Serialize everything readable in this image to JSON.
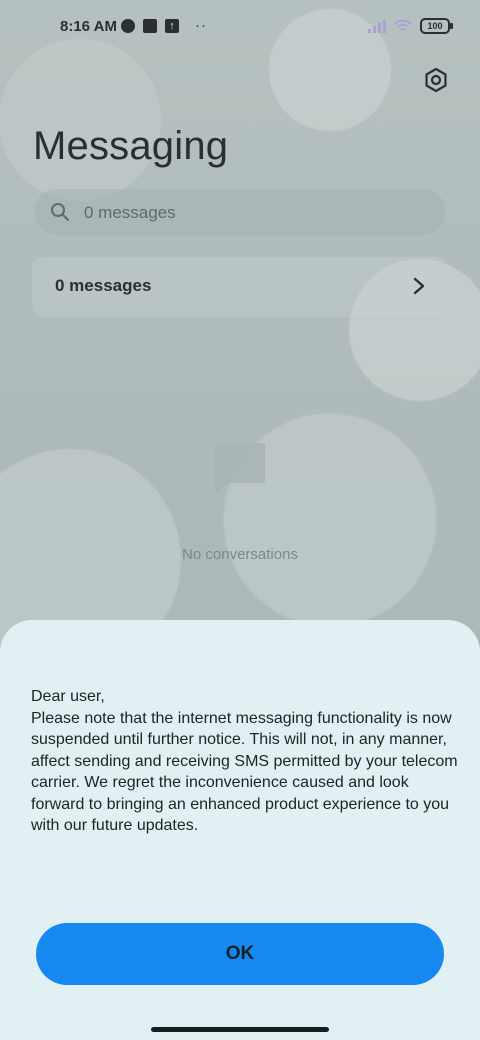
{
  "status_bar": {
    "time": "8:16 AM",
    "battery": "100"
  },
  "header": {
    "title": "Messaging"
  },
  "search": {
    "placeholder": "0 messages"
  },
  "messages_row": {
    "label": "0 messages"
  },
  "empty_state": {
    "text": "No conversations"
  },
  "dialog": {
    "message": "Dear user,\nPlease note that the internet messaging functionality is now suspended until further notice. This will not, in any manner, affect sending and receiving SMS permitted by your telecom carrier. We regret the inconvenience caused and look forward to bringing an enhanced product experience to you with our future updates.",
    "ok_label": "OK"
  },
  "icons": {
    "settings": "settings-icon",
    "search": "search-icon",
    "chevron": "chevron-right-icon",
    "empty": "chat-bubble-icon"
  },
  "colors": {
    "accent": "#1689f0",
    "sheet_background": "#e1f0f2"
  }
}
